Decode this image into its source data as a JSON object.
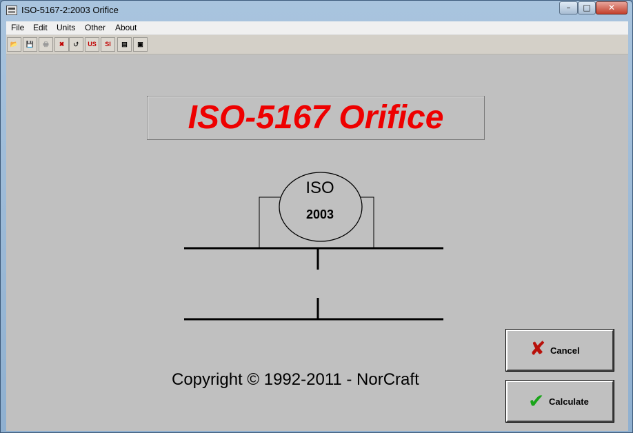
{
  "window": {
    "title": "ISO-5167-2:2003 Orifice",
    "controls": {
      "minimize": "–",
      "maximize": "□",
      "close": "✕"
    }
  },
  "menu": [
    "File",
    "Edit",
    "Units",
    "Other",
    "About"
  ],
  "toolbar": {
    "tools": [
      {
        "name": "open-icon",
        "glyph": "📂",
        "enabled": false
      },
      {
        "name": "save-icon",
        "glyph": "💾",
        "enabled": false
      },
      {
        "name": "print-icon",
        "glyph": "🖶",
        "enabled": false
      },
      {
        "name": "delete-icon",
        "glyph": "✖",
        "enabled": true
      },
      {
        "name": "folder-up-icon",
        "glyph": "⮍",
        "enabled": true
      },
      {
        "name": "us-units-icon",
        "glyph": "US",
        "enabled": true
      },
      {
        "name": "si-units-icon",
        "glyph": "SI",
        "enabled": true
      },
      {
        "name": "chart-icon",
        "glyph": "▤",
        "enabled": true
      },
      {
        "name": "disk-icon",
        "glyph": "▣",
        "enabled": true
      }
    ]
  },
  "banner": {
    "title": "ISO-5167 Orifice",
    "color": "#ee0000"
  },
  "logo": {
    "top": "ISO",
    "bottom": "2003"
  },
  "footer": {
    "copyright": "Copyright © 1992-2011 -  NorCraft"
  },
  "buttons": {
    "cancel": {
      "label": "Cancel",
      "icon": "red-x-icon"
    },
    "calculate": {
      "label": "Calculate",
      "icon": "green-check-icon"
    }
  }
}
